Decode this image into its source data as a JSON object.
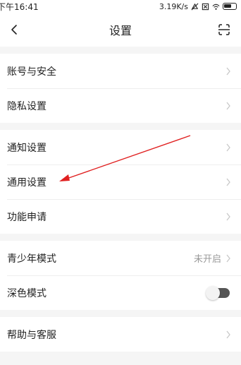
{
  "status_bar": {
    "time": "下午16:41",
    "net_speed": "3.19K/s"
  },
  "header": {
    "title": "设置",
    "back_icon": "chevron-left-icon",
    "scan_icon": "scan-icon"
  },
  "groups": [
    {
      "items": [
        {
          "label": "账号与安全"
        },
        {
          "label": "隐私设置"
        }
      ]
    },
    {
      "items": [
        {
          "label": "通知设置"
        },
        {
          "label": "通用设置"
        },
        {
          "label": "功能申请"
        }
      ]
    },
    {
      "items": [
        {
          "label": "青少年模式",
          "status": "未开启"
        },
        {
          "label": "深色模式",
          "toggle": false
        }
      ]
    },
    {
      "items": [
        {
          "label": "帮助与客服"
        }
      ]
    }
  ],
  "colors": {
    "annotation_arrow": "#e02020",
    "background": "#f5f5f5",
    "chevron": "#c8c8c8"
  }
}
